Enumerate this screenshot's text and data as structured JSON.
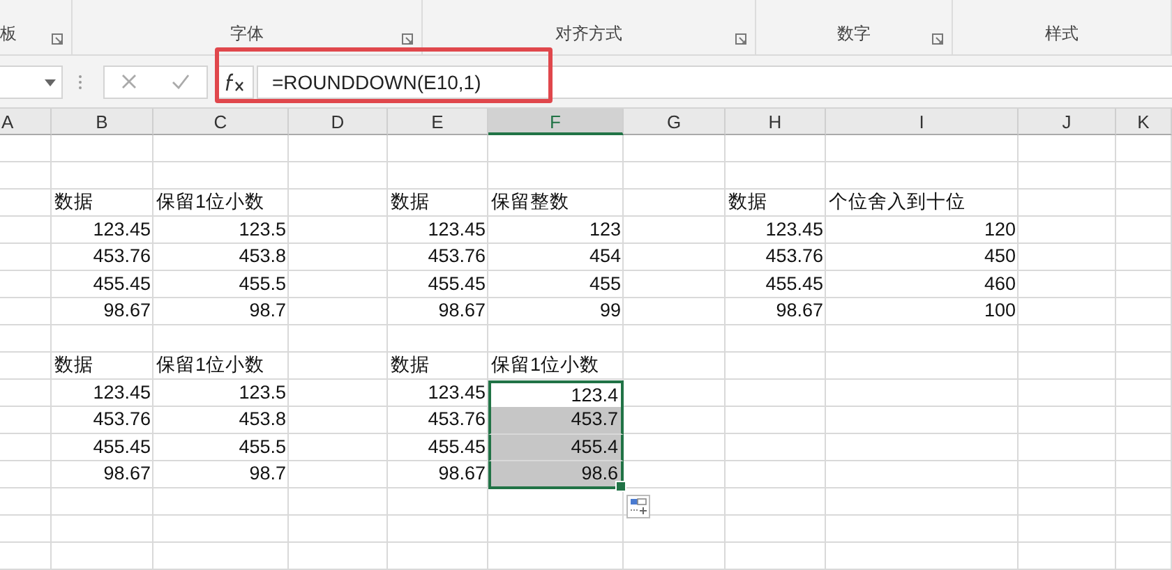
{
  "ribbon": {
    "groups": [
      {
        "label": "板",
        "launcher": true
      },
      {
        "label": "字体",
        "launcher": true
      },
      {
        "label": "对齐方式",
        "launcher": true
      },
      {
        "label": "数字",
        "launcher": true
      },
      {
        "label": "样式",
        "launcher": false
      }
    ]
  },
  "formula_bar": {
    "formula": "=ROUNDDOWN(E10,1)",
    "highlighted": true
  },
  "columns": [
    {
      "label": "A",
      "selected": false
    },
    {
      "label": "B",
      "selected": false
    },
    {
      "label": "C",
      "selected": false
    },
    {
      "label": "D",
      "selected": false
    },
    {
      "label": "E",
      "selected": false
    },
    {
      "label": "F",
      "selected": true
    },
    {
      "label": "G",
      "selected": false
    },
    {
      "label": "H",
      "selected": false
    },
    {
      "label": "I",
      "selected": false
    },
    {
      "label": "J",
      "selected": false
    },
    {
      "label": "K",
      "selected": false
    }
  ],
  "rows": [
    {
      "cells": {}
    },
    {
      "cells": {}
    },
    {
      "cells": {
        "B": {
          "text": "数据",
          "kind": "text",
          "selected": false
        },
        "C": {
          "text": "保留1位小数",
          "kind": "text",
          "selected": false
        },
        "E": {
          "text": "数据",
          "kind": "text",
          "selected": false
        },
        "F": {
          "text": "保留整数",
          "kind": "text",
          "selected": false
        },
        "H": {
          "text": "数据",
          "kind": "text",
          "selected": false
        },
        "I": {
          "text": "个位舍入到十位",
          "kind": "text",
          "selected": false
        }
      }
    },
    {
      "cells": {
        "B": {
          "text": "123.45",
          "kind": "number",
          "selected": false
        },
        "C": {
          "text": "123.5",
          "kind": "number",
          "selected": false
        },
        "E": {
          "text": "123.45",
          "kind": "number",
          "selected": false
        },
        "F": {
          "text": "123",
          "kind": "number",
          "selected": false
        },
        "H": {
          "text": "123.45",
          "kind": "number",
          "selected": false
        },
        "I": {
          "text": "120",
          "kind": "number",
          "selected": false
        }
      }
    },
    {
      "cells": {
        "B": {
          "text": "453.76",
          "kind": "number",
          "selected": false
        },
        "C": {
          "text": "453.8",
          "kind": "number",
          "selected": false
        },
        "E": {
          "text": "453.76",
          "kind": "number",
          "selected": false
        },
        "F": {
          "text": "454",
          "kind": "number",
          "selected": false
        },
        "H": {
          "text": "453.76",
          "kind": "number",
          "selected": false
        },
        "I": {
          "text": "450",
          "kind": "number",
          "selected": false
        }
      }
    },
    {
      "cells": {
        "B": {
          "text": "455.45",
          "kind": "number",
          "selected": false
        },
        "C": {
          "text": "455.5",
          "kind": "number",
          "selected": false
        },
        "E": {
          "text": "455.45",
          "kind": "number",
          "selected": false
        },
        "F": {
          "text": "455",
          "kind": "number",
          "selected": false
        },
        "H": {
          "text": "455.45",
          "kind": "number",
          "selected": false
        },
        "I": {
          "text": "460",
          "kind": "number",
          "selected": false
        }
      }
    },
    {
      "cells": {
        "B": {
          "text": "98.67",
          "kind": "number",
          "selected": false
        },
        "C": {
          "text": "98.7",
          "kind": "number",
          "selected": false
        },
        "E": {
          "text": "98.67",
          "kind": "number",
          "selected": false
        },
        "F": {
          "text": "99",
          "kind": "number",
          "selected": false
        },
        "H": {
          "text": "98.67",
          "kind": "number",
          "selected": false
        },
        "I": {
          "text": "100",
          "kind": "number",
          "selected": false
        }
      }
    },
    {
      "cells": {}
    },
    {
      "cells": {
        "B": {
          "text": "数据",
          "kind": "text",
          "selected": false
        },
        "C": {
          "text": "保留1位小数",
          "kind": "text",
          "selected": false
        },
        "E": {
          "text": "数据",
          "kind": "text",
          "selected": false
        },
        "F": {
          "text": "保留1位小数",
          "kind": "text",
          "selected": false
        }
      }
    },
    {
      "cells": {
        "B": {
          "text": "123.45",
          "kind": "number",
          "selected": false
        },
        "C": {
          "text": "123.5",
          "kind": "number",
          "selected": false
        },
        "E": {
          "text": "123.45",
          "kind": "number",
          "selected": false
        },
        "F": {
          "text": "123.4",
          "kind": "number",
          "selected": true,
          "active": true
        }
      }
    },
    {
      "cells": {
        "B": {
          "text": "453.76",
          "kind": "number",
          "selected": false
        },
        "C": {
          "text": "453.8",
          "kind": "number",
          "selected": false
        },
        "E": {
          "text": "453.76",
          "kind": "number",
          "selected": false
        },
        "F": {
          "text": "453.7",
          "kind": "number",
          "selected": true,
          "active": false
        }
      }
    },
    {
      "cells": {
        "B": {
          "text": "455.45",
          "kind": "number",
          "selected": false
        },
        "C": {
          "text": "455.5",
          "kind": "number",
          "selected": false
        },
        "E": {
          "text": "455.45",
          "kind": "number",
          "selected": false
        },
        "F": {
          "text": "455.4",
          "kind": "number",
          "selected": true,
          "active": false
        }
      }
    },
    {
      "cells": {
        "B": {
          "text": "98.67",
          "kind": "number",
          "selected": false
        },
        "C": {
          "text": "98.7",
          "kind": "number",
          "selected": false
        },
        "E": {
          "text": "98.67",
          "kind": "number",
          "selected": false
        },
        "F": {
          "text": "98.6",
          "kind": "number",
          "selected": true,
          "active": false
        }
      }
    },
    {
      "cells": {}
    },
    {
      "cells": {}
    },
    {
      "cells": {}
    }
  ]
}
